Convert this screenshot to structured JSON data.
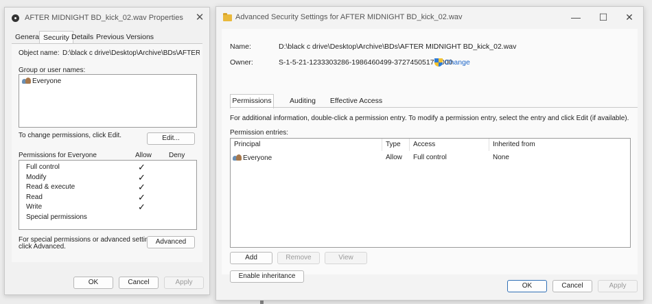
{
  "props_dialog": {
    "title": "AFTER MIDNIGHT BD_kick_02.wav Properties",
    "tabs": [
      "General",
      "Security",
      "Details",
      "Previous Versions"
    ],
    "object_name_label": "Object name:",
    "object_name_value": "D:\\black c drive\\Desktop\\Archive\\BDs\\AFTER M",
    "group_label": "Group or user names:",
    "groups": [
      "Everyone"
    ],
    "change_text": "To change permissions, click Edit.",
    "edit_button": "Edit...",
    "perms_for_label": "Permissions for Everyone",
    "allow_header": "Allow",
    "deny_header": "Deny",
    "permissions": [
      {
        "name": "Full control",
        "allow": true
      },
      {
        "name": "Modify",
        "allow": true
      },
      {
        "name": "Read & execute",
        "allow": true
      },
      {
        "name": "Read",
        "allow": true
      },
      {
        "name": "Write",
        "allow": true
      },
      {
        "name": "Special permissions",
        "allow": false
      }
    ],
    "check_glyph": "✓",
    "special_text_1": "For special permissions or advanced settings,",
    "special_text_2": "click Advanced.",
    "advanced_button": "Advanced",
    "ok_button": "OK",
    "cancel_button": "Cancel",
    "apply_button": "Apply"
  },
  "advanced_window": {
    "title": "Advanced Security Settings for AFTER MIDNIGHT BD_kick_02.wav",
    "name_label": "Name:",
    "name_value": "D:\\black c drive\\Desktop\\Archive\\BDs\\AFTER MIDNIGHT BD_kick_02.wav",
    "owner_label": "Owner:",
    "owner_value": "S-1-5-21-1233303286-1986460499-3727450517-1000",
    "change_link": "Change",
    "tabs": [
      "Permissions",
      "Auditing",
      "Effective Access"
    ],
    "info_text": "For additional information, double-click a permission entry. To modify a permission entry, select the entry and click Edit (if available).",
    "entries_label": "Permission entries:",
    "columns": [
      "Principal",
      "Type",
      "Access",
      "Inherited from"
    ],
    "entries": [
      {
        "principal": "Everyone",
        "type": "Allow",
        "access": "Full control",
        "inherited": "None"
      }
    ],
    "add_button": "Add",
    "remove_button": "Remove",
    "view_button": "View",
    "inheritance_button": "Enable inheritance",
    "ok_button": "OK",
    "cancel_button": "Cancel",
    "apply_button": "Apply"
  },
  "window_controls": {
    "minimize": "—",
    "maximize": "☐",
    "close": "✕"
  }
}
